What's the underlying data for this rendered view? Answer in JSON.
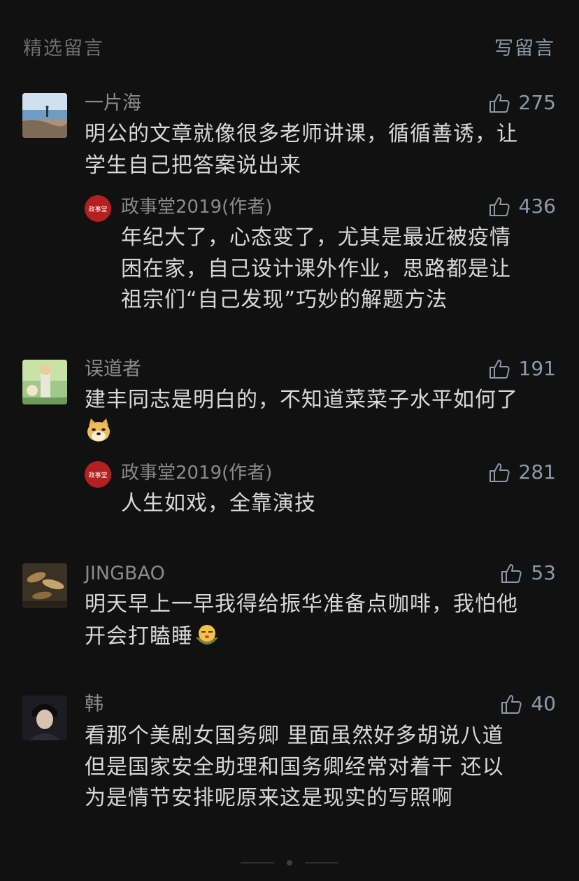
{
  "header": {
    "title": "精选留言",
    "write_label": "写留言"
  },
  "colors": {
    "background": "#111111",
    "accent": "#8e99a8",
    "author_badge": "#b41f1f"
  },
  "comments": [
    {
      "name": "一片海",
      "likes": "275",
      "text_lines": [
        "明公的文章就像很多老师讲课，循循善诱，让",
        "学生自己把答案说出来"
      ],
      "reply": {
        "name": "政事堂2019(作者)",
        "likes": "436",
        "avatar_glyphs": "政事堂",
        "text_lines": [
          "年纪大了，心态变了，尤其是最近被疫情",
          "困在家，自己设计课外作业，思路都是让",
          "祖宗们“自己发现”巧妙的解题方法"
        ]
      }
    },
    {
      "name": "误道者",
      "likes": "191",
      "text_lines": [
        "建丰同志是明白的，不知道菜菜子水平如何了"
      ],
      "emoji": "doge-emoji",
      "reply": {
        "name": "政事堂2019(作者)",
        "likes": "281",
        "avatar_glyphs": "政事堂",
        "text_lines": [
          "人生如戏，全靠演技"
        ]
      }
    },
    {
      "name": "JINGBAO",
      "likes": "53",
      "text_lines": [
        "明天早上一早我得给振华准备点咖啡，我怕他",
        "开会打瞌睡"
      ],
      "emoji": "sleepy-melon-emoji"
    },
    {
      "name": "韩",
      "likes": "40",
      "text_lines": [
        "看那个美剧女国务卿 里面虽然好多胡说八道",
        "但是国家安全助理和国务卿经常对着干 还以",
        "为是情节安排呢原来这是现实的写照啊"
      ]
    }
  ]
}
